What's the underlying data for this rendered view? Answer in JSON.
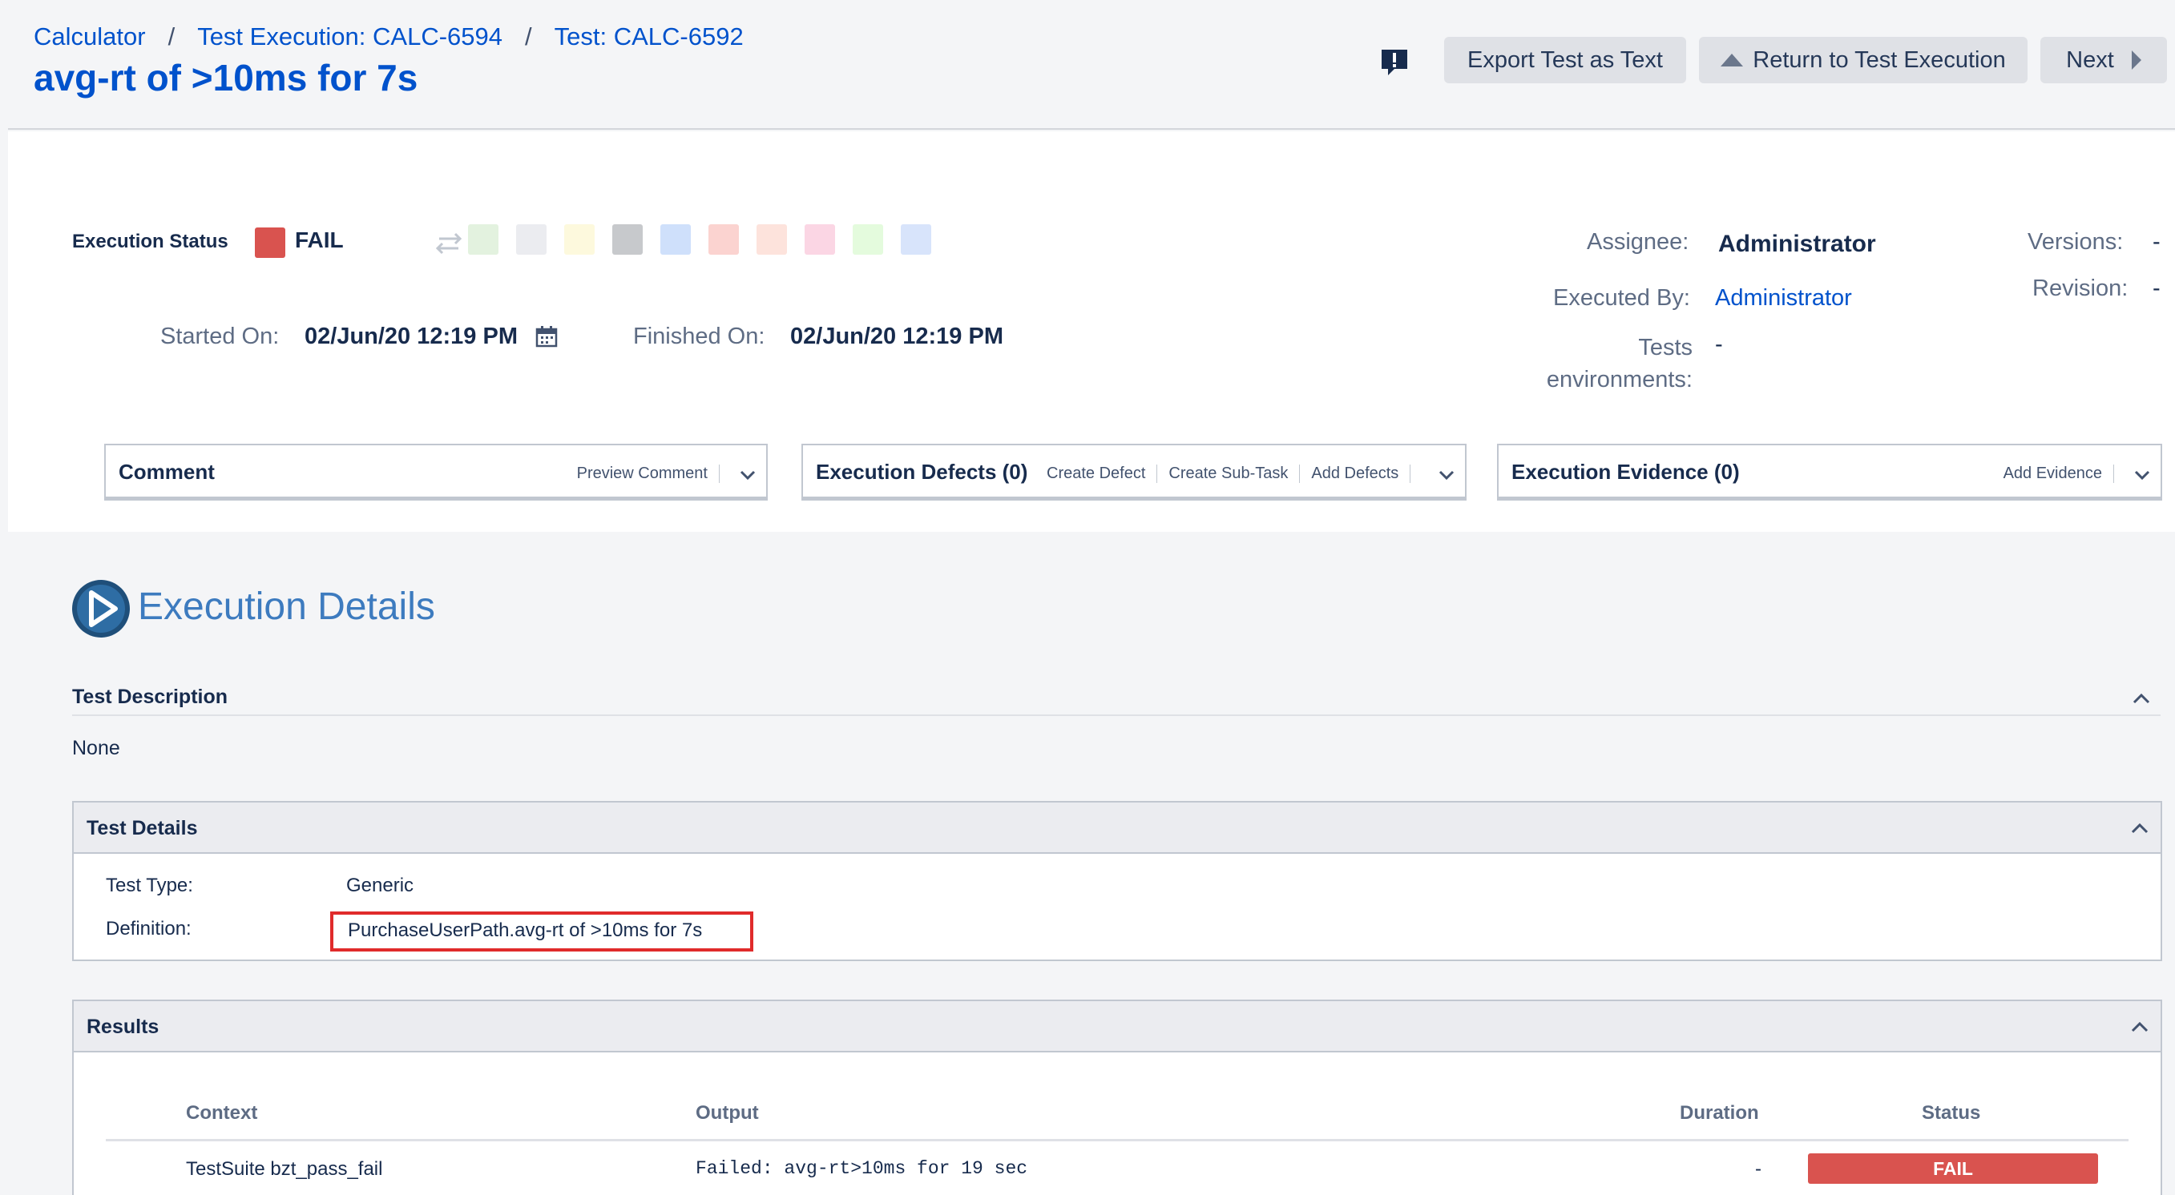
{
  "header": {
    "breadcrumbs": [
      {
        "label": "Calculator"
      },
      {
        "label": "Test Execution: CALC-6594"
      },
      {
        "label": "Test: CALC-6592"
      }
    ],
    "separator": "/",
    "title": "avg-rt of >10ms for 7s",
    "buttons": {
      "export": "Export Test as Text",
      "return": "Return to Test Execution",
      "next": "Next"
    }
  },
  "execution": {
    "status_label": "Execution Status",
    "status_value": "FAIL",
    "status_color": "#d9534f",
    "status_options_colors": [
      "#e3f2df",
      "#ebecf0",
      "#fdf9dd",
      "#c7c9cc",
      "#cfe0fb",
      "#fbd3d0",
      "#fde3dc",
      "#fbd6e4",
      "#e4fbdd",
      "#d8e4fb"
    ],
    "started_label": "Started On:",
    "started_value": "02/Jun/20 12:19 PM",
    "finished_label": "Finished On:",
    "finished_value": "02/Jun/20 12:19 PM",
    "assignee_label": "Assignee:",
    "assignee_value": "Administrator",
    "executed_by_label": "Executed By:",
    "executed_by_value": "Administrator",
    "tests_env_label": "Tests environments:",
    "tests_env_value": "-",
    "versions_label": "Versions:",
    "versions_value": "-",
    "revision_label": "Revision:",
    "revision_value": "-"
  },
  "panels": {
    "comment": {
      "title": "Comment",
      "links": [
        "Preview Comment"
      ]
    },
    "defects": {
      "title": "Execution Defects (0)",
      "links": [
        "Create Defect",
        "Create Sub-Task",
        "Add Defects"
      ]
    },
    "evidence": {
      "title": "Execution Evidence (0)",
      "links": [
        "Add Evidence"
      ]
    }
  },
  "details": {
    "heading": "Execution Details",
    "description_title": "Test Description",
    "description_value": "None",
    "test_details_title": "Test Details",
    "test_type_label": "Test Type:",
    "test_type_value": "Generic",
    "definition_label": "Definition:",
    "definition_value": "PurchaseUserPath.avg-rt of >10ms for 7s"
  },
  "results": {
    "title": "Results",
    "columns": [
      "Context",
      "Output",
      "Duration",
      "Status"
    ],
    "rows": [
      {
        "context": "TestSuite bzt_pass_fail",
        "output": "Failed: avg-rt>10ms for 19 sec",
        "duration": "-",
        "status": "FAIL"
      }
    ]
  },
  "icons": {
    "feedback": "feedback-icon",
    "swap": "swap-arrows-icon",
    "calendar": "calendar-icon",
    "chevron_down": "chevron-down-icon",
    "chevron_up": "chevron-up-icon",
    "logo": "play-logo-icon"
  },
  "colors": {
    "link": "#0052cc",
    "fail": "#d9534f",
    "highlight_border": "#e02b2b"
  }
}
